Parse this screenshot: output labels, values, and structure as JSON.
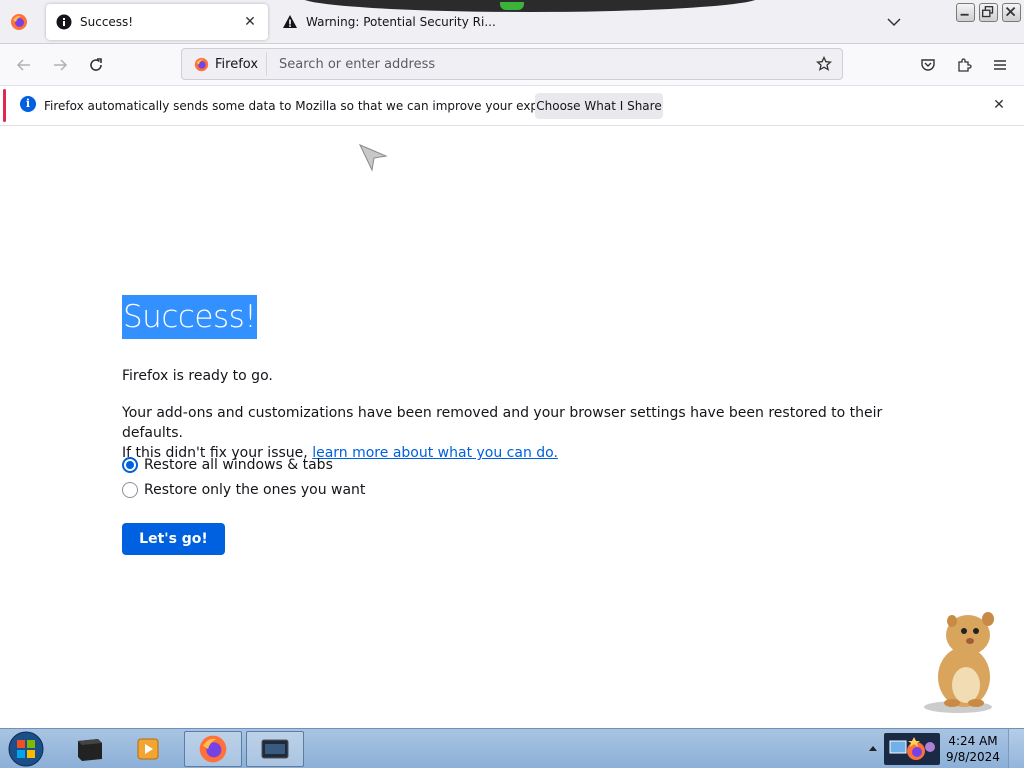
{
  "browser": {
    "tabs": [
      {
        "title": "Success!",
        "active": true
      },
      {
        "title": "Warning: Potential Security Ri...",
        "active": false
      }
    ]
  },
  "navbar": {
    "identity_label": "Firefox",
    "url_placeholder": "Search or enter address"
  },
  "notification": {
    "message": "Firefox automatically sends some data to Mozilla so that we can improve your experience.",
    "button_label": "Choose What I Share"
  },
  "page": {
    "title": "Success!",
    "ready_text": "Firefox is ready to go.",
    "description_line1": "Your add-ons and customizations have been removed and your browser settings have been restored to their defaults.",
    "description_line2_prefix": "If this didn't fix your issue, ",
    "description_link": "learn more about what you can do.",
    "options": [
      {
        "label": "Restore all windows & tabs",
        "checked": true
      },
      {
        "label": "Restore only the ones you want",
        "checked": false
      }
    ],
    "go_button": "Let's go!"
  },
  "taskbar": {
    "clock_time": "4:24 AM",
    "clock_date": "9/8/2024"
  },
  "colors": {
    "accent_blue": "#0060df",
    "selection_blue": "#3390ff",
    "notify_accent": "#e22850"
  }
}
